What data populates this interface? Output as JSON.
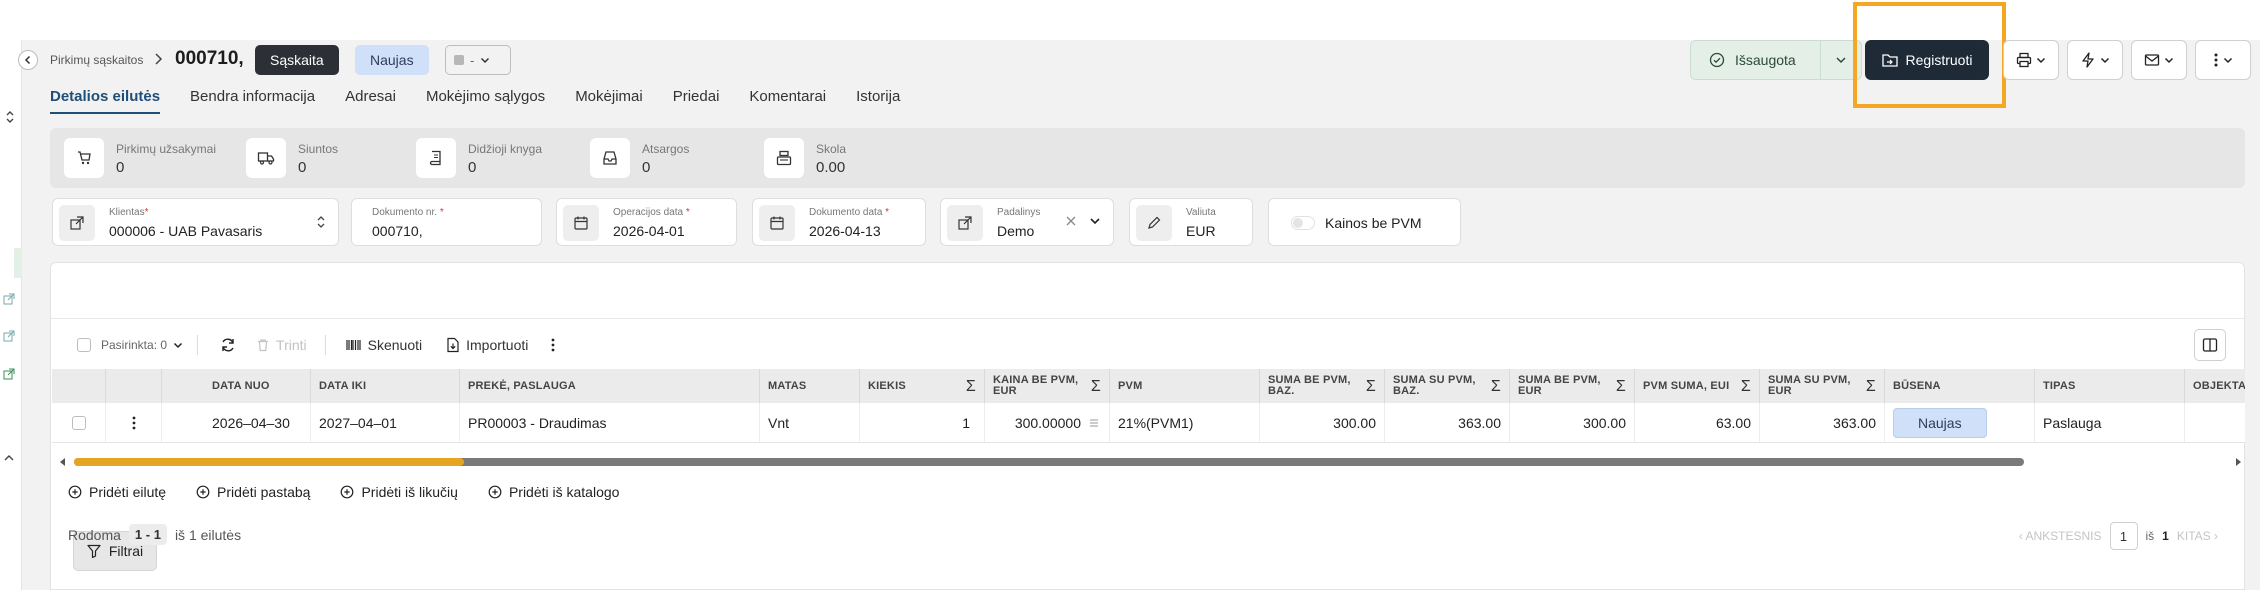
{
  "header": {
    "breadcrumb": "Pirkimų sąskaitos",
    "doc_number": "000710,",
    "type_tag": "Sąskaita",
    "status_tag": "Naujas",
    "state_select": "-"
  },
  "toolbar": {
    "saved_label": "Išsaugota",
    "register_label": "Registruoti",
    "accent": "#1f2a37",
    "highlight_color": "#f5a623"
  },
  "tabs": [
    "Detalios eilutės",
    "Bendra informacija",
    "Adresai",
    "Mokėjimo sąlygos",
    "Mokėjimai",
    "Priedai",
    "Komentarai",
    "Istorija"
  ],
  "summary": [
    {
      "label": "Pirkimų užsakymai",
      "value": "0",
      "icon": "cart-icon"
    },
    {
      "label": "Siuntos",
      "value": "0",
      "icon": "truck-icon"
    },
    {
      "label": "Didžioji knyga",
      "value": "0",
      "icon": "book-icon"
    },
    {
      "label": "Atsargos",
      "value": "0",
      "icon": "inbox-icon"
    },
    {
      "label": "Skola",
      "value": "0.00",
      "icon": "cash-register-icon"
    }
  ],
  "fields": {
    "client": {
      "label": "Klientas",
      "value": "000006 - UAB Pavasaris"
    },
    "doc_no": {
      "label": "Dokumento nr.",
      "value": "000710,"
    },
    "op_date": {
      "label": "Operacijos data",
      "value": "2026-04-01"
    },
    "doc_date": {
      "label": "Dokumento data",
      "value": "2026-04-13"
    },
    "division": {
      "label": "Padalinys",
      "value": "Demo"
    },
    "currency": {
      "label": "Valiuta",
      "value": "EUR"
    },
    "prices_no_vat": {
      "label": "Kainos be PVM"
    }
  },
  "grid": {
    "filter_label": "Filtrai",
    "selected_label": "Pasirinkta: 0",
    "delete_label": "Trinti",
    "scan_label": "Skenuoti",
    "import_label": "Importuoti",
    "columns": [
      "DATA NUO",
      "DATA IKI",
      "PREKĖ, PASLAUGA",
      "MATAS",
      "KIEKIS",
      "KAINA BE PVM, EUR",
      "PVM",
      "SUMA BE PVM, BAZ.",
      "SUMA SU PVM, BAZ.",
      "SUMA BE PVM, EUR",
      "PVM SUMA, EUI",
      "SUMA SU PVM, EUR",
      "BŪSENA",
      "TIPAS",
      "OBJEKTAS"
    ],
    "rows": [
      {
        "date_from": "2026–04–30",
        "date_to": "2027–04–01",
        "item": "PR00003 - Draudimas",
        "unit": "Vnt",
        "qty": "1",
        "price": "300.00000",
        "vat": "21%(PVM1)",
        "sum_no_vat_base": "300.00",
        "sum_vat_base": "363.00",
        "sum_no_vat_eur": "300.00",
        "vat_sum": "63.00",
        "sum_vat_eur": "363.00",
        "status": "Naujas",
        "type": "Paslauga"
      }
    ],
    "scroll_fraction": 0.2
  },
  "add_actions": [
    "Pridėti eilutę",
    "Pridėti pastabą",
    "Pridėti iš likučių",
    "Pridėti iš katalogo"
  ],
  "footer": {
    "showing": "Rodoma",
    "range": "1 - 1",
    "of_rows": "iš 1 eilutės",
    "prev": "ANKSTESNIS",
    "page": "1",
    "of": "iš",
    "total_pages": "1",
    "next": "KITAS"
  }
}
